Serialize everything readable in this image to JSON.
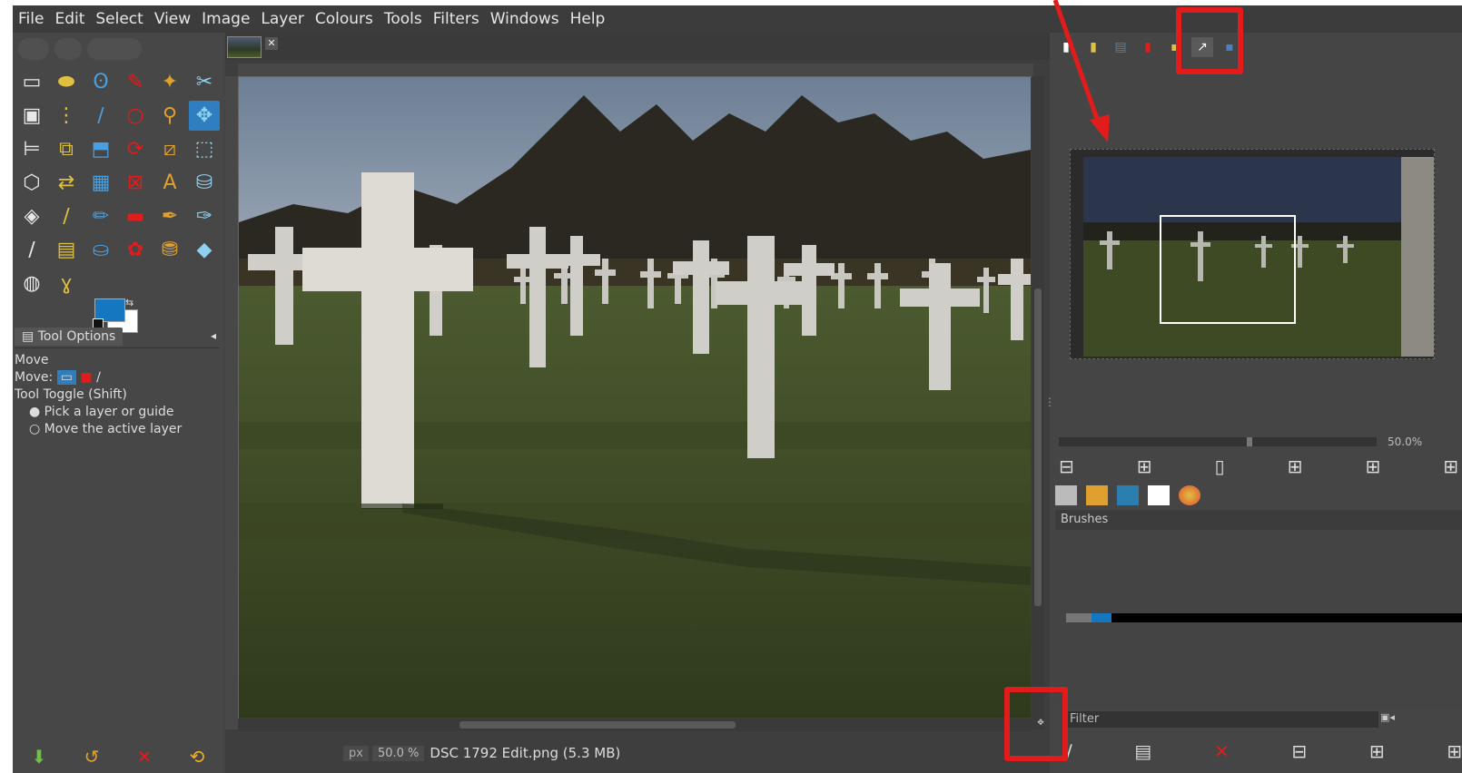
{
  "menubar": {
    "items": [
      "File",
      "Edit",
      "Select",
      "View",
      "Image",
      "Layer",
      "Colours",
      "Tools",
      "Filters",
      "Windows",
      "Help"
    ]
  },
  "toolbox": {
    "tools": [
      {
        "name": "rect-select-icon",
        "glyph": "▭"
      },
      {
        "name": "free-select-icon",
        "glyph": "⬬"
      },
      {
        "name": "lasso-icon",
        "glyph": "ʘ"
      },
      {
        "name": "fuzzy-select-icon",
        "glyph": "✎"
      },
      {
        "name": "by-color-select-icon",
        "glyph": "✦"
      },
      {
        "name": "scissors-icon",
        "glyph": "✂"
      },
      {
        "name": "foreground-select-icon",
        "glyph": "▣"
      },
      {
        "name": "paths-icon",
        "glyph": "⋮"
      },
      {
        "name": "color-picker-icon",
        "glyph": "∕"
      },
      {
        "name": "zoom-icon",
        "glyph": "○"
      },
      {
        "name": "measure-icon",
        "glyph": "⚲"
      },
      {
        "name": "move-icon",
        "glyph": "✥"
      },
      {
        "name": "align-icon",
        "glyph": "⊨"
      },
      {
        "name": "crop-icon",
        "glyph": "⧉"
      },
      {
        "name": "unified-transform-icon",
        "glyph": "⬒"
      },
      {
        "name": "rotate-icon",
        "glyph": "⟳"
      },
      {
        "name": "shear-icon",
        "glyph": "⧄"
      },
      {
        "name": "scale-icon",
        "glyph": "⬚"
      },
      {
        "name": "perspective-icon",
        "glyph": "⬡"
      },
      {
        "name": "flip-icon",
        "glyph": "⇄"
      },
      {
        "name": "cage-icon",
        "glyph": "▦"
      },
      {
        "name": "warp-icon",
        "glyph": "⊠"
      },
      {
        "name": "text-icon",
        "glyph": "A"
      },
      {
        "name": "bucket-fill-icon",
        "glyph": "⛁"
      },
      {
        "name": "gradient-icon",
        "glyph": "◈"
      },
      {
        "name": "pencil-icon",
        "glyph": "∕"
      },
      {
        "name": "paintbrush-icon",
        "glyph": "✏"
      },
      {
        "name": "eraser-icon",
        "glyph": "▬"
      },
      {
        "name": "airbrush-icon",
        "glyph": "✒"
      },
      {
        "name": "ink-icon",
        "glyph": "✑"
      },
      {
        "name": "mypaint-brush-icon",
        "glyph": "∕"
      },
      {
        "name": "clone-icon",
        "glyph": "▤"
      },
      {
        "name": "heal-icon",
        "glyph": "⛀"
      },
      {
        "name": "perspective-clone-icon",
        "glyph": "✿"
      },
      {
        "name": "blur-icon",
        "glyph": "⛃"
      },
      {
        "name": "smudge-icon",
        "glyph": "◆"
      },
      {
        "name": "dodge-burn-icon",
        "glyph": "◍"
      },
      {
        "name": "smudge-tool-icon",
        "glyph": "ɣ"
      }
    ],
    "colors": {
      "foreground": "#1477c0",
      "background": "#ffffff"
    },
    "options_tab": "Tool Options",
    "options": {
      "title": "Move",
      "move_label": "Move:",
      "toggle_label": "Tool Toggle (Shift)",
      "radio_1": "Pick a layer or guide",
      "radio_2": "Move the active layer"
    }
  },
  "image_window": {
    "status": {
      "unit": "px",
      "zoom": "50.0 %",
      "filename": "DSC 1792 Edit.png (5.3 MB)"
    }
  },
  "dock": {
    "navigation_zoom": "50.0%",
    "brushes_header": "Brushes",
    "filter_placeholder": "Filter",
    "tabs": [
      "tool-options-tab",
      "device-status-tab",
      "images-tab",
      "undo-history-tab",
      "layers-tab",
      "navigation-tab",
      "pointer-tab"
    ]
  },
  "annotations": {
    "highlight_color": "#e21b1b"
  }
}
